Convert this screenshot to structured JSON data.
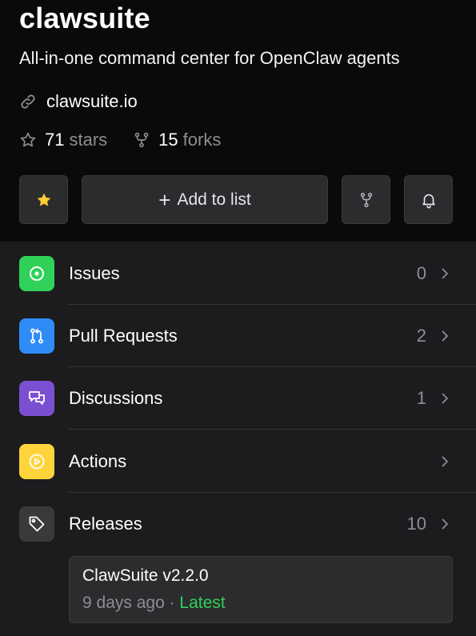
{
  "repo": {
    "name": "clawsuite",
    "description": "All-in-one command center for OpenClaw agents",
    "website": "clawsuite.io",
    "stars_count": "71",
    "stars_label": "stars",
    "forks_count": "15",
    "forks_label": "forks"
  },
  "actions": {
    "add_to_list_label": "Add to list",
    "plus_glyph": "+"
  },
  "icons": {
    "link": "link-icon",
    "star_outline": "star-outline-icon",
    "fork": "fork-icon",
    "star_filled": "star-filled-icon",
    "bell": "bell-icon",
    "chevron": "chevron-right-icon"
  },
  "sections": [
    {
      "label": "Issues",
      "count": "0",
      "icon": "issue-circle-icon",
      "color": "#30d158"
    },
    {
      "label": "Pull Requests",
      "count": "2",
      "icon": "pull-request-icon",
      "color": "#2f8cf7"
    },
    {
      "label": "Discussions",
      "count": "1",
      "icon": "discussions-icon",
      "color": "#7b4fd1"
    },
    {
      "label": "Actions",
      "count": "",
      "icon": "play-circle-icon",
      "color": "#ffd43b"
    },
    {
      "label": "Releases",
      "count": "10",
      "icon": "tag-icon",
      "color": "#3a3a3c"
    }
  ],
  "latest_release": {
    "title": "ClawSuite v2.2.0",
    "age": "9 days ago",
    "separator": " · ",
    "badge": "Latest"
  },
  "colors": {
    "star_yellow": "#ffcc33",
    "latest_green": "#30d158",
    "muted_text": "#8e8e93"
  }
}
